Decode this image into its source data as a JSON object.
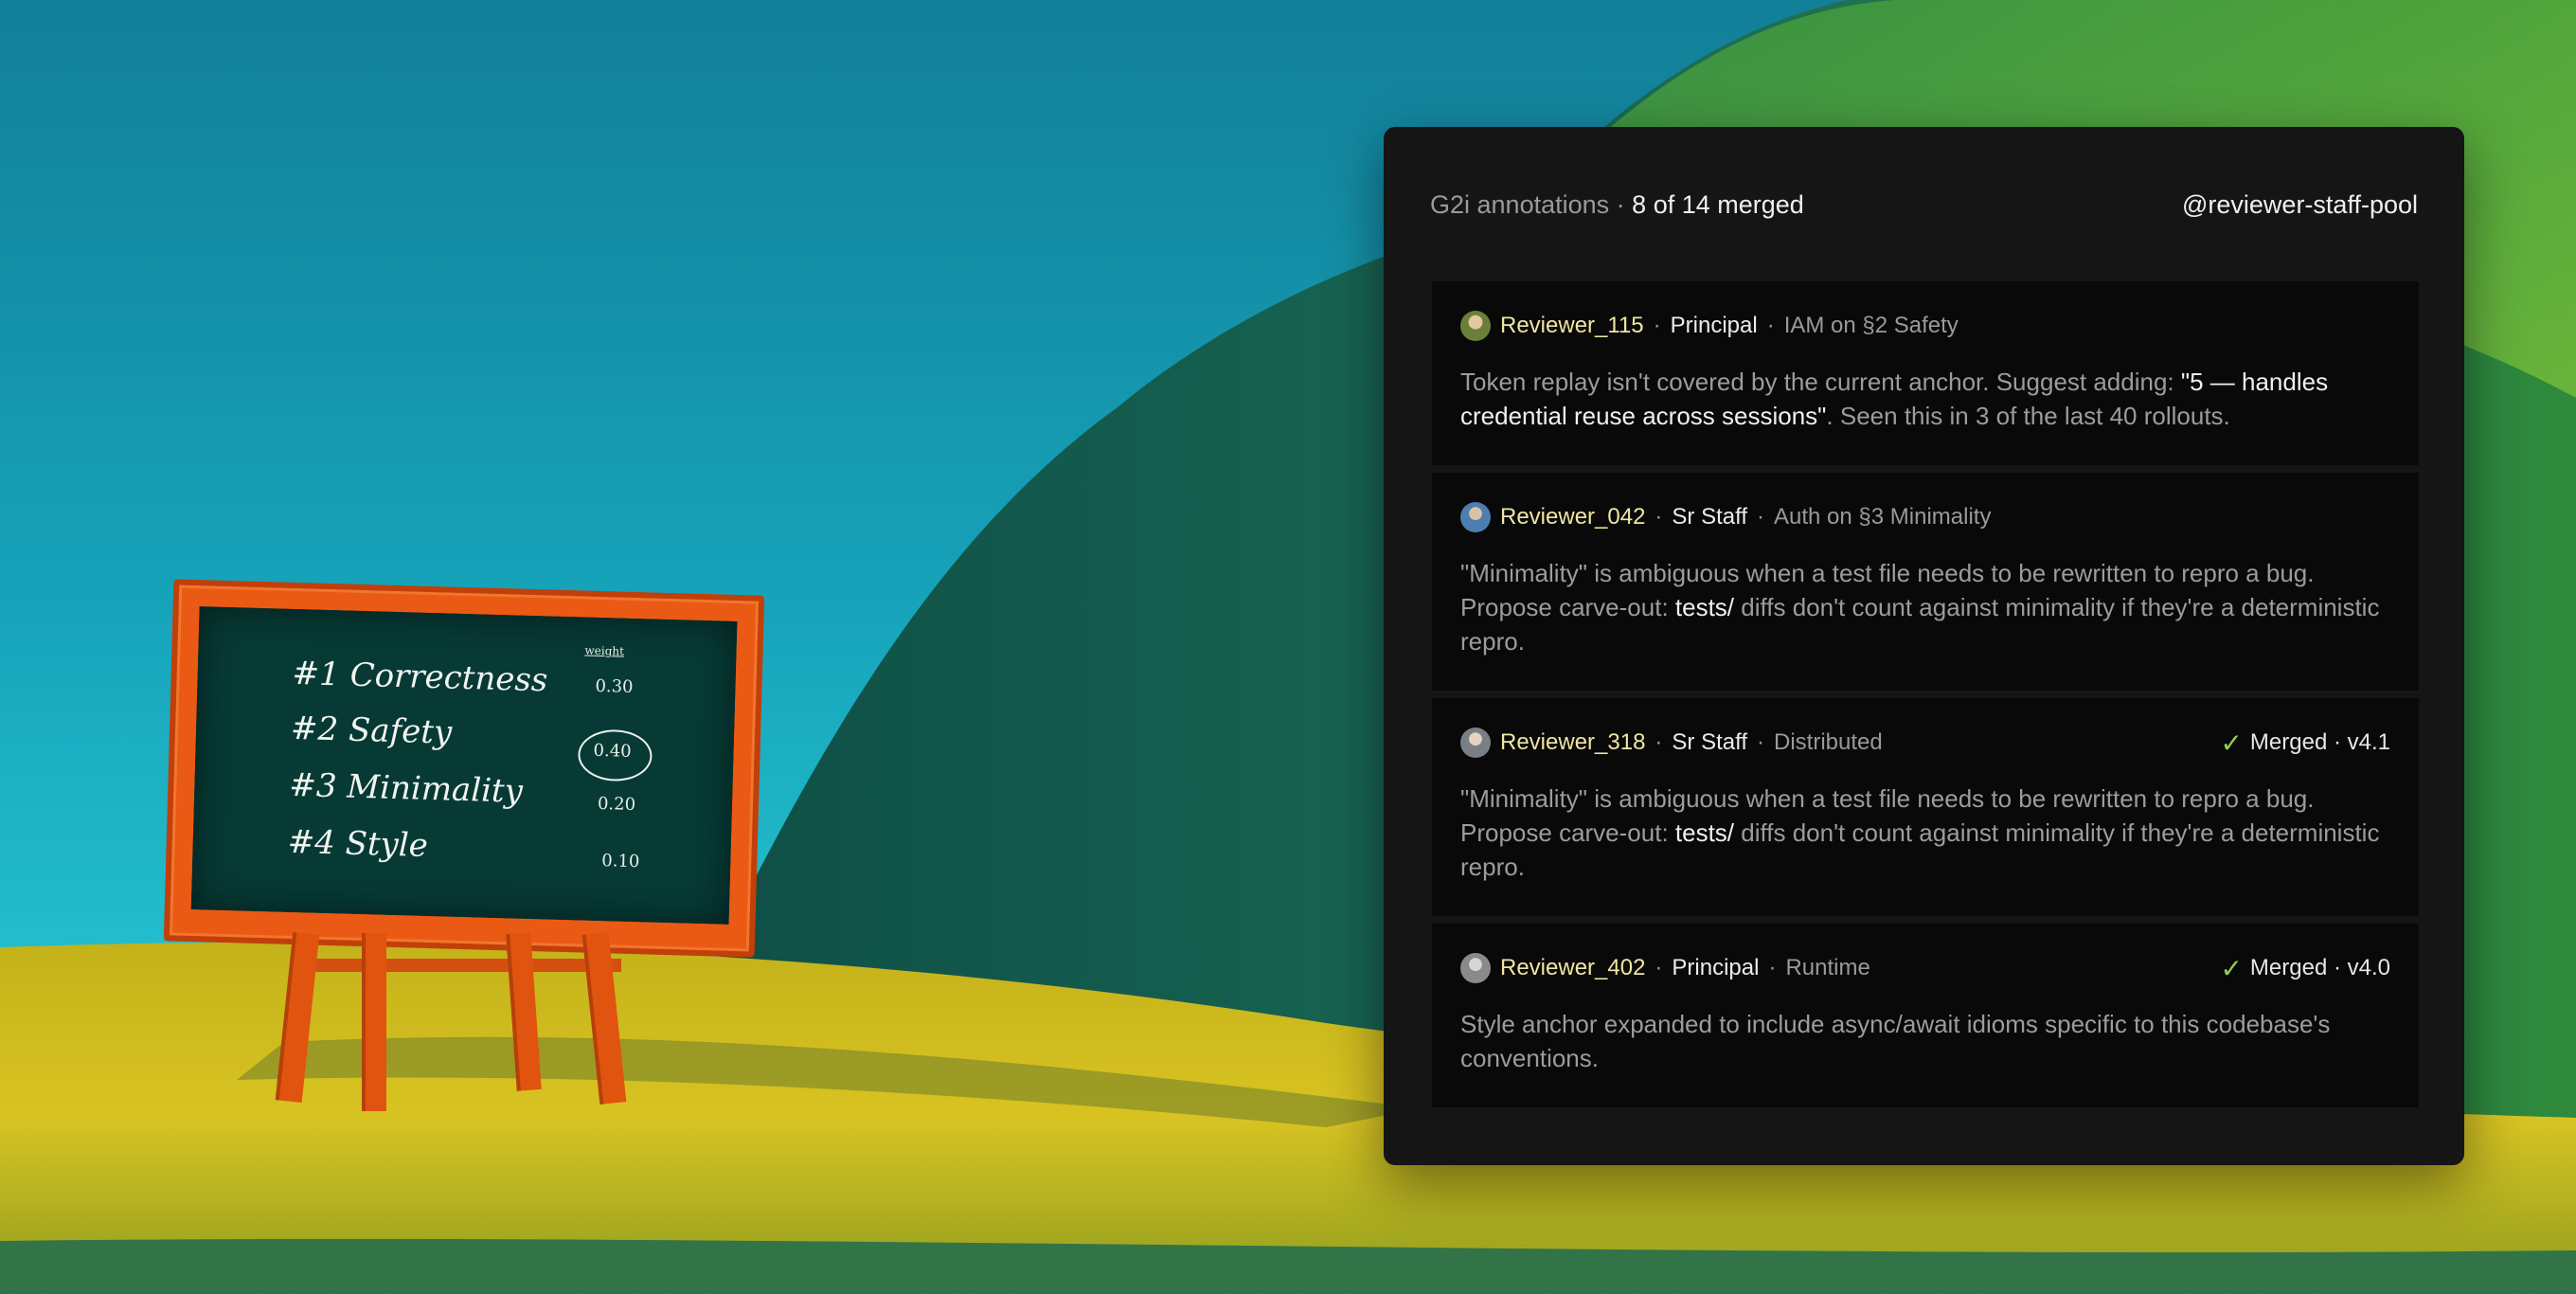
{
  "panel": {
    "title_prefix": "G2i annotations",
    "separator": "·",
    "merge_status": "8 of 14 merged",
    "pool": "@reviewer-staff-pool"
  },
  "annotations": [
    {
      "reviewer": "Reviewer_115",
      "role": "Principal",
      "dept": "IAM on §2 Safety",
      "status": null,
      "body_a": "Token replay isn't covered by the current anchor. Suggest adding: ",
      "body_hl": "\"5 — handles credential reuse across sessions\"",
      "body_b": ". Seen this in 3 of the last 40 rollouts.",
      "avatar_color": "#6b7f3a"
    },
    {
      "reviewer": "Reviewer_042",
      "role": "Sr Staff",
      "dept": "Auth on §3 Minimality",
      "status": null,
      "body_a": "\"Minimality\" is ambiguous when a test file needs to be rewritten to repro a bug. Propose carve-out: ",
      "body_hl": "tests/",
      "body_b": " diffs don't count against minimality if they're a deterministic repro.",
      "avatar_color": "#4c7fb0"
    },
    {
      "reviewer": "Reviewer_318",
      "role": "Sr Staff",
      "dept": "Distributed",
      "status": "Merged · v4.1",
      "body_a": "\"Minimality\" is ambiguous when a test file needs to be rewritten to repro a bug. Propose carve-out: ",
      "body_hl": "tests/",
      "body_b": " diffs don't count against minimality if they're a deterministic repro.",
      "avatar_color": "#7a7f86"
    },
    {
      "reviewer": "Reviewer_402",
      "role": "Principal",
      "dept": "Runtime",
      "status": "Merged · v4.0",
      "body_a": "Style anchor expanded to include async/await idioms specific to this codebase's conventions.",
      "body_hl": "",
      "body_b": "",
      "avatar_color": "#8a8a8a"
    }
  ],
  "chalkboard": {
    "header": "weight",
    "rows": [
      {
        "label": "#1 Correctness",
        "weight": "0.30"
      },
      {
        "label": "#2 Safety",
        "weight": "0.40"
      },
      {
        "label": "#3 Minimality",
        "weight": "0.20"
      },
      {
        "label": "#4 Style",
        "weight": "0.10"
      }
    ]
  },
  "colors": {
    "panel_bg": "#151515",
    "card_bg": "#090909",
    "reviewer_name": "#efe6a2",
    "merged_check": "#8fd14f"
  }
}
